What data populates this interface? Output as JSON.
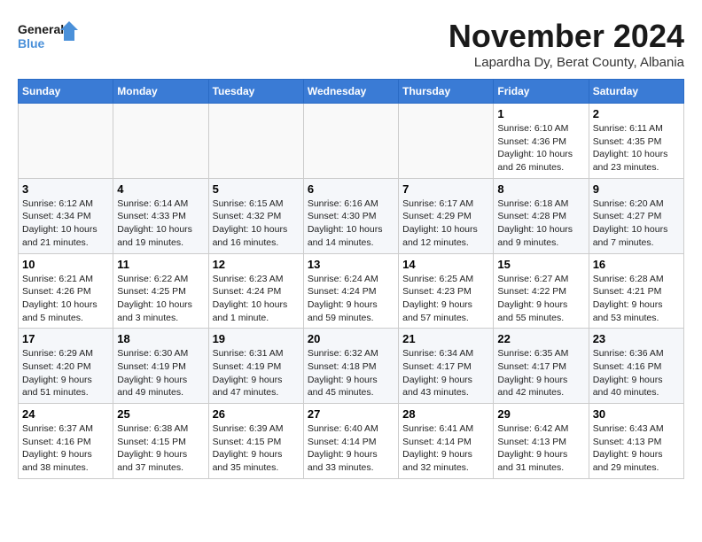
{
  "logo": {
    "line1": "General",
    "line2": "Blue"
  },
  "title": "November 2024",
  "location": "Lapardha Dy, Berat County, Albania",
  "weekdays": [
    "Sunday",
    "Monday",
    "Tuesday",
    "Wednesday",
    "Thursday",
    "Friday",
    "Saturday"
  ],
  "weeks": [
    [
      {
        "day": "",
        "info": ""
      },
      {
        "day": "",
        "info": ""
      },
      {
        "day": "",
        "info": ""
      },
      {
        "day": "",
        "info": ""
      },
      {
        "day": "",
        "info": ""
      },
      {
        "day": "1",
        "info": "Sunrise: 6:10 AM\nSunset: 4:36 PM\nDaylight: 10 hours and 26 minutes."
      },
      {
        "day": "2",
        "info": "Sunrise: 6:11 AM\nSunset: 4:35 PM\nDaylight: 10 hours and 23 minutes."
      }
    ],
    [
      {
        "day": "3",
        "info": "Sunrise: 6:12 AM\nSunset: 4:34 PM\nDaylight: 10 hours and 21 minutes."
      },
      {
        "day": "4",
        "info": "Sunrise: 6:14 AM\nSunset: 4:33 PM\nDaylight: 10 hours and 19 minutes."
      },
      {
        "day": "5",
        "info": "Sunrise: 6:15 AM\nSunset: 4:32 PM\nDaylight: 10 hours and 16 minutes."
      },
      {
        "day": "6",
        "info": "Sunrise: 6:16 AM\nSunset: 4:30 PM\nDaylight: 10 hours and 14 minutes."
      },
      {
        "day": "7",
        "info": "Sunrise: 6:17 AM\nSunset: 4:29 PM\nDaylight: 10 hours and 12 minutes."
      },
      {
        "day": "8",
        "info": "Sunrise: 6:18 AM\nSunset: 4:28 PM\nDaylight: 10 hours and 9 minutes."
      },
      {
        "day": "9",
        "info": "Sunrise: 6:20 AM\nSunset: 4:27 PM\nDaylight: 10 hours and 7 minutes."
      }
    ],
    [
      {
        "day": "10",
        "info": "Sunrise: 6:21 AM\nSunset: 4:26 PM\nDaylight: 10 hours and 5 minutes."
      },
      {
        "day": "11",
        "info": "Sunrise: 6:22 AM\nSunset: 4:25 PM\nDaylight: 10 hours and 3 minutes."
      },
      {
        "day": "12",
        "info": "Sunrise: 6:23 AM\nSunset: 4:24 PM\nDaylight: 10 hours and 1 minute."
      },
      {
        "day": "13",
        "info": "Sunrise: 6:24 AM\nSunset: 4:24 PM\nDaylight: 9 hours and 59 minutes."
      },
      {
        "day": "14",
        "info": "Sunrise: 6:25 AM\nSunset: 4:23 PM\nDaylight: 9 hours and 57 minutes."
      },
      {
        "day": "15",
        "info": "Sunrise: 6:27 AM\nSunset: 4:22 PM\nDaylight: 9 hours and 55 minutes."
      },
      {
        "day": "16",
        "info": "Sunrise: 6:28 AM\nSunset: 4:21 PM\nDaylight: 9 hours and 53 minutes."
      }
    ],
    [
      {
        "day": "17",
        "info": "Sunrise: 6:29 AM\nSunset: 4:20 PM\nDaylight: 9 hours and 51 minutes."
      },
      {
        "day": "18",
        "info": "Sunrise: 6:30 AM\nSunset: 4:19 PM\nDaylight: 9 hours and 49 minutes."
      },
      {
        "day": "19",
        "info": "Sunrise: 6:31 AM\nSunset: 4:19 PM\nDaylight: 9 hours and 47 minutes."
      },
      {
        "day": "20",
        "info": "Sunrise: 6:32 AM\nSunset: 4:18 PM\nDaylight: 9 hours and 45 minutes."
      },
      {
        "day": "21",
        "info": "Sunrise: 6:34 AM\nSunset: 4:17 PM\nDaylight: 9 hours and 43 minutes."
      },
      {
        "day": "22",
        "info": "Sunrise: 6:35 AM\nSunset: 4:17 PM\nDaylight: 9 hours and 42 minutes."
      },
      {
        "day": "23",
        "info": "Sunrise: 6:36 AM\nSunset: 4:16 PM\nDaylight: 9 hours and 40 minutes."
      }
    ],
    [
      {
        "day": "24",
        "info": "Sunrise: 6:37 AM\nSunset: 4:16 PM\nDaylight: 9 hours and 38 minutes."
      },
      {
        "day": "25",
        "info": "Sunrise: 6:38 AM\nSunset: 4:15 PM\nDaylight: 9 hours and 37 minutes."
      },
      {
        "day": "26",
        "info": "Sunrise: 6:39 AM\nSunset: 4:15 PM\nDaylight: 9 hours and 35 minutes."
      },
      {
        "day": "27",
        "info": "Sunrise: 6:40 AM\nSunset: 4:14 PM\nDaylight: 9 hours and 33 minutes."
      },
      {
        "day": "28",
        "info": "Sunrise: 6:41 AM\nSunset: 4:14 PM\nDaylight: 9 hours and 32 minutes."
      },
      {
        "day": "29",
        "info": "Sunrise: 6:42 AM\nSunset: 4:13 PM\nDaylight: 9 hours and 31 minutes."
      },
      {
        "day": "30",
        "info": "Sunrise: 6:43 AM\nSunset: 4:13 PM\nDaylight: 9 hours and 29 minutes."
      }
    ]
  ]
}
